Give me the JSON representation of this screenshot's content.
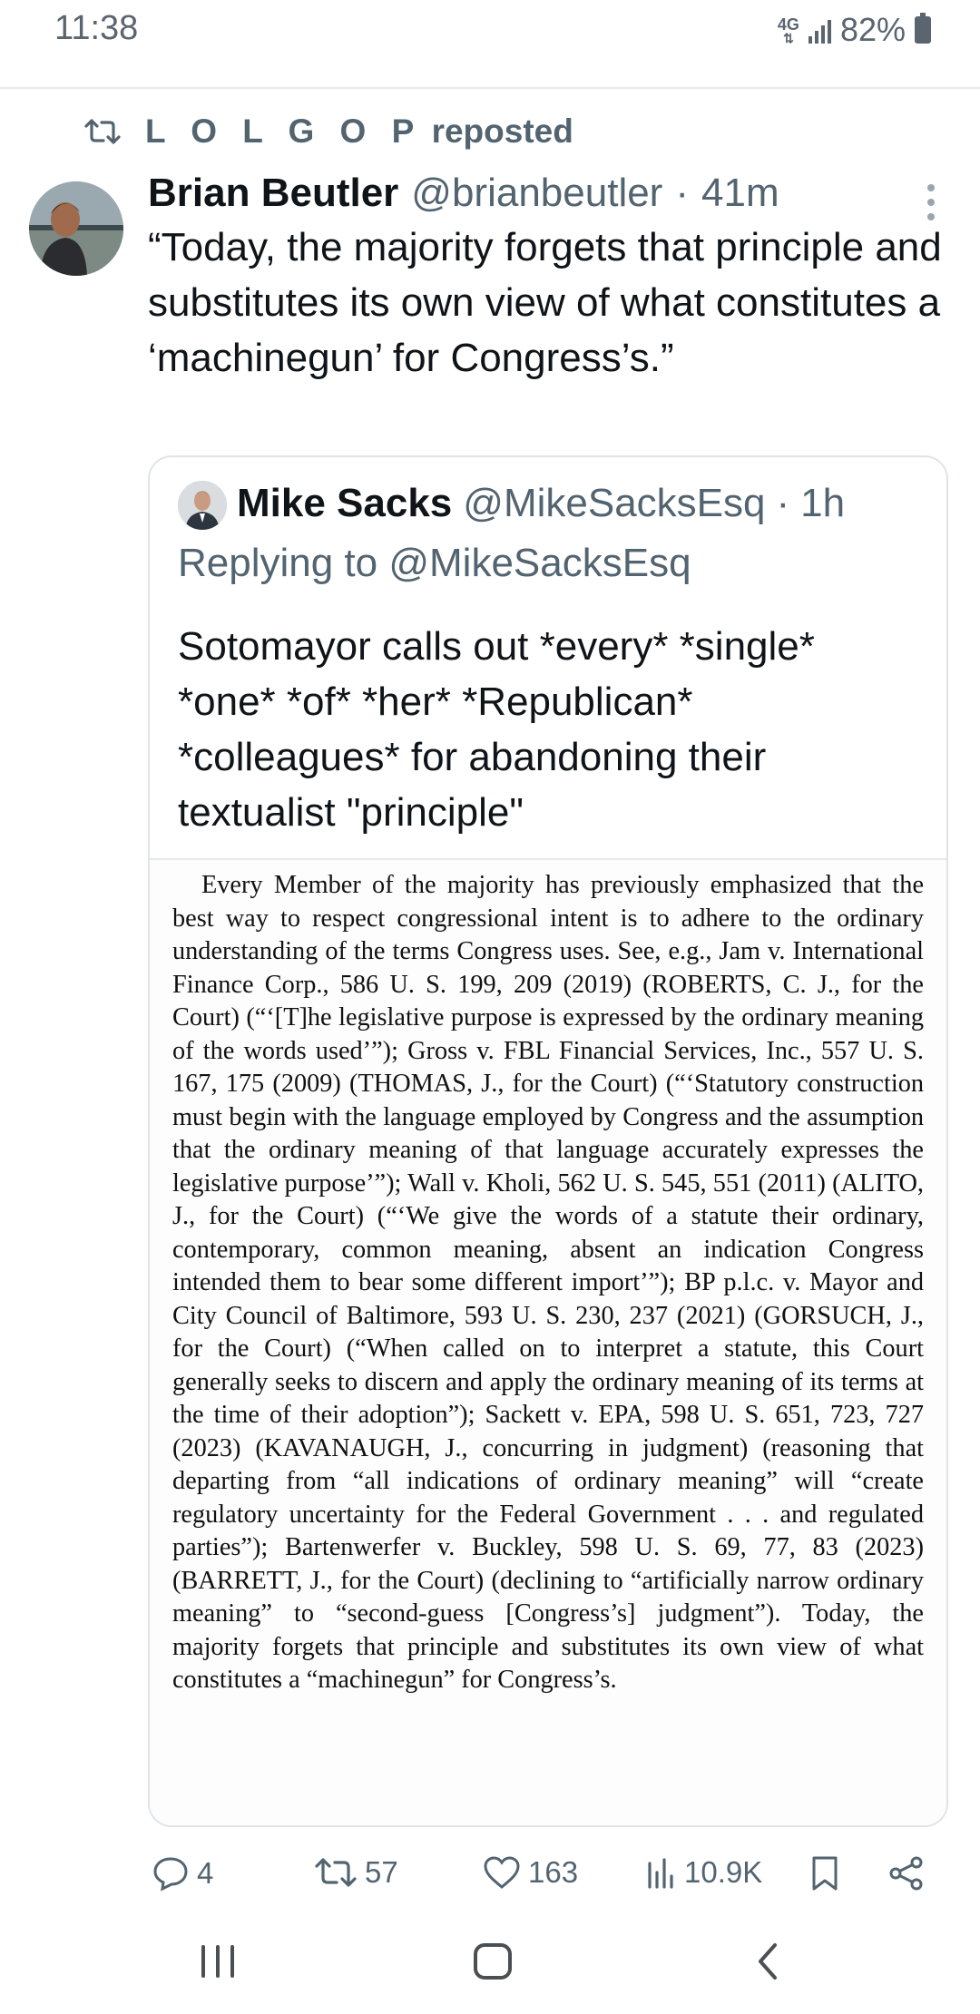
{
  "status_bar": {
    "time": "11:38",
    "network": "4G",
    "battery": "82%"
  },
  "repost": {
    "name": "L O L G O P",
    "suffix": "reposted"
  },
  "tweet": {
    "author": "Brian Beutler",
    "handle": "@brianbeutler",
    "separator": "·",
    "time": "41m",
    "text": "“Today, the majority forgets that principle and substitutes its own view of what constitutes a ‘machinegun’ for Congress’s.”"
  },
  "quote": {
    "author": "Mike Sacks",
    "handle": "@MikeSacksEsq",
    "separator": "·",
    "time": "1h",
    "replying_to": "Replying to @MikeSacksEsq",
    "text": "Sotomayor calls out *every* *single* *one* *of* *her* *Republican* *colleagues* for abandoning their textualist \"principle\"",
    "image_text": "Every Member of the majority has previously emphasized that the best way to respect congressional intent is to adhere to the ordinary understanding of the terms Congress uses. See, e.g., Jam v. International Finance Corp., 586 U. S. 199, 209 (2019) (ROBERTS, C. J., for the Court) (“‘[T]he legislative purpose is expressed by the ordinary meaning of the words used’”); Gross v. FBL Financial Services, Inc., 557 U. S. 167, 175 (2009) (THOMAS, J., for the Court) (“‘Statutory construction must begin with the language employed by Congress and the assumption that the ordinary meaning of that language accurately expresses the legislative purpose’”); Wall v. Kholi, 562 U. S. 545, 551 (2011) (ALITO, J., for the Court) (“‘We give the words of a statute their ordinary, contemporary, common meaning, absent an indication Congress intended them to bear some different import’”); BP p.l.c. v. Mayor and City Council of Baltimore, 593 U. S. 230, 237 (2021) (GORSUCH, J., for the Court) (“When called on to interpret a statute, this Court generally seeks to discern and apply the ordinary meaning of its terms at the time of their adoption”); Sackett v. EPA, 598 U. S. 651, 723, 727 (2023) (KAVANAUGH, J., concurring in judgment) (reasoning that departing from “all indications of ordinary meaning” will “create regulatory uncertainty for the Federal Government . . . and regulated parties”); Bartenwerfer v. Buckley, 598 U. S. 69, 77, 83 (2023) (BARRETT, J., for the Court) (declining to “artificially narrow ordinary meaning” to “second-guess [Congress’s] judgment”). Today, the majority forgets that principle and substitutes its own view of what constitutes a “machinegun” for Congress’s."
  },
  "actions": {
    "replies": "4",
    "reposts": "57",
    "likes": "163",
    "views": "10.9K"
  },
  "icons": {
    "repost": "repost-icon",
    "reply": "reply-icon",
    "like": "heart-icon",
    "views": "views-icon",
    "bookmark": "bookmark-icon",
    "share": "share-icon",
    "more": "more-icon",
    "recents": "recents-icon",
    "home": "home-icon",
    "back": "back-icon"
  },
  "colors": {
    "text": "#0f1419",
    "secondary": "#536471",
    "border": "#e0e4e8"
  }
}
